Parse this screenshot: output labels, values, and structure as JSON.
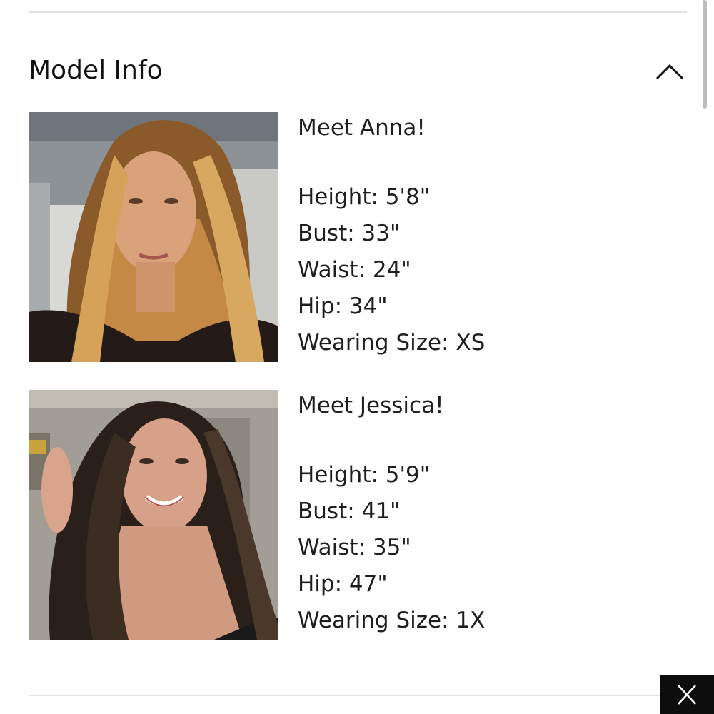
{
  "section": {
    "title": "Model Info",
    "toggle_icon": "chevron-up-icon"
  },
  "models": [
    {
      "intro": "Meet Anna!",
      "stats": [
        "Height: 5'8\"",
        "Bust: 33\"",
        "Waist: 24\"",
        "Hip: 34\"",
        "Wearing Size: XS"
      ]
    },
    {
      "intro": "Meet Jessica!",
      "stats": [
        "Height: 5'9\"",
        "Bust: 41\"",
        "Waist: 35\"",
        "Hip: 47\"",
        "Wearing Size: 1X"
      ]
    }
  ],
  "overlay": {
    "close_icon": "close-icon"
  }
}
